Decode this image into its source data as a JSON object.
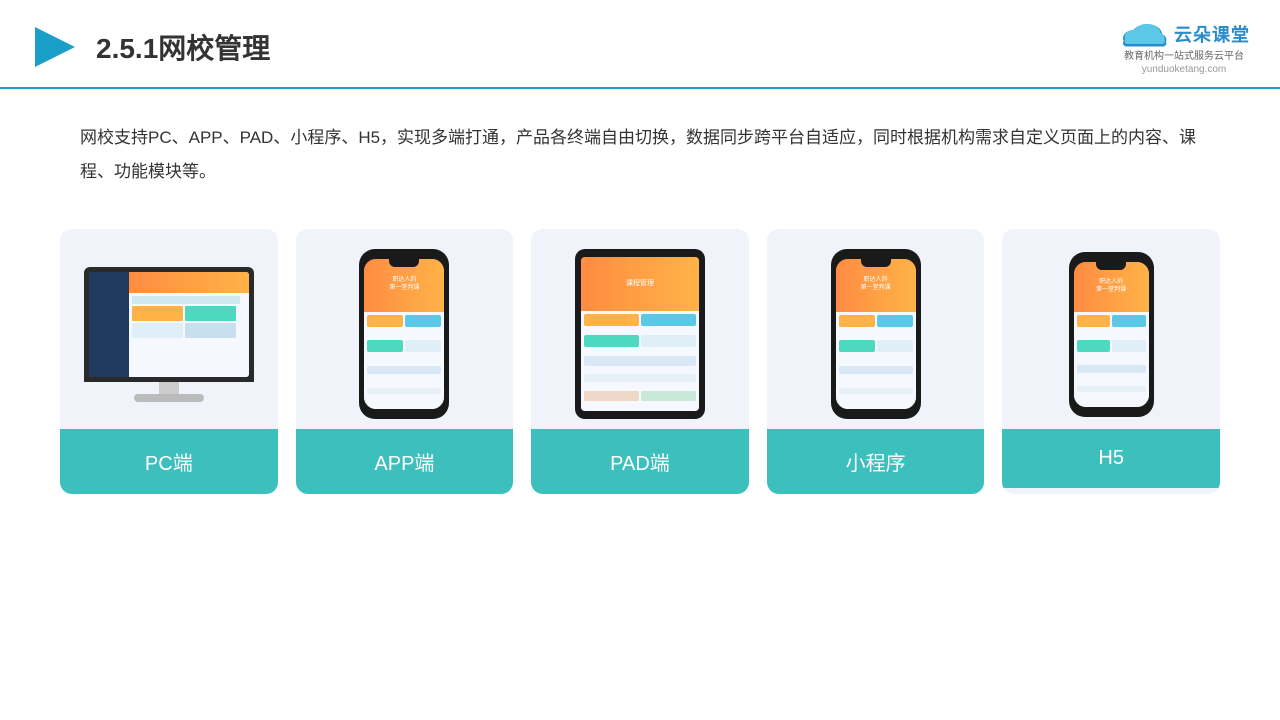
{
  "header": {
    "title": "2.5.1网校管理",
    "logo_main": "云朵课堂",
    "logo_domain": "yunduoketang.com",
    "logo_tagline": "教育机构一站\n式服务云平台"
  },
  "description": "网校支持PC、APP、PAD、小程序、H5，实现多端打通，产品各终端自由切换，数据同步跨平台自适应，同时根据机构需求自定义页面上的内容、课程、功能模块等。",
  "cards": [
    {
      "id": "pc",
      "label": "PC端",
      "type": "pc"
    },
    {
      "id": "app",
      "label": "APP端",
      "type": "phone"
    },
    {
      "id": "pad",
      "label": "PAD端",
      "type": "tablet"
    },
    {
      "id": "mini",
      "label": "小程序",
      "type": "phone"
    },
    {
      "id": "h5",
      "label": "H5",
      "type": "phone"
    }
  ],
  "colors": {
    "accent": "#3dbfbe",
    "header_line": "#1a9fc8",
    "card_bg": "#f0f4fa",
    "title_color": "#333"
  }
}
